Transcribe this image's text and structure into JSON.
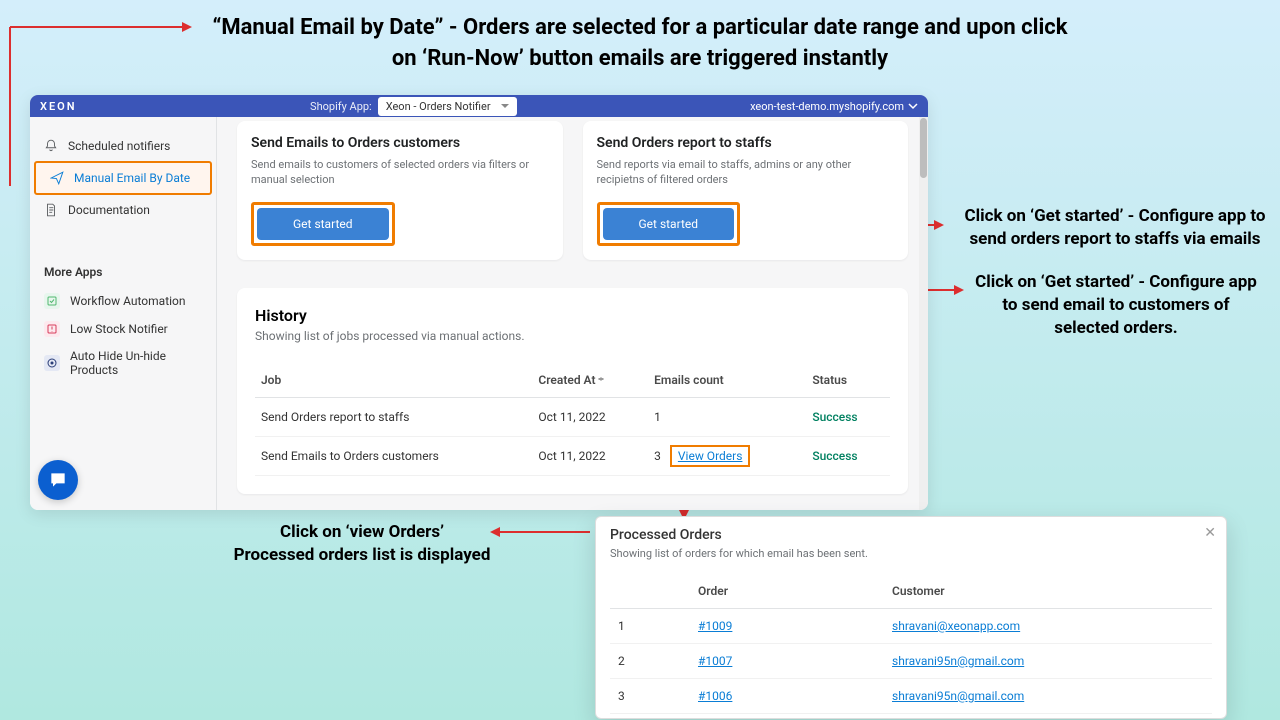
{
  "top_annotation": "“Manual Email by Date” - Orders are selected for a particular date range and upon click on ‘Run-Now’ button emails are triggered instantly",
  "header": {
    "brand": "XEON",
    "app_label": "Shopify App:",
    "app_selected": "Xeon - Orders Notifier",
    "shop_url": "xeon-test-demo.myshopify.com"
  },
  "sidebar": {
    "items": [
      {
        "label": "Scheduled notifiers",
        "icon": "bell-icon"
      },
      {
        "label": "Manual Email By Date",
        "icon": "paper-plane-icon",
        "active": true
      },
      {
        "label": "Documentation",
        "icon": "document-icon"
      }
    ],
    "more_apps_title": "More Apps",
    "apps": [
      {
        "label": "Workflow Automation",
        "icon_color": "#50b86f"
      },
      {
        "label": "Low Stock Notifier",
        "icon_color": "#d83a5a"
      },
      {
        "label": "Auto Hide Un-hide Products",
        "icon_color": "#2b3e78"
      }
    ]
  },
  "cards": [
    {
      "title": "Send Emails to Orders customers",
      "desc": "Send emails to customers of selected orders via filters or manual selection",
      "cta": "Get started"
    },
    {
      "title": "Send Orders report to staffs",
      "desc": "Send reports via email to staffs, admins or any other recipietns of filtered orders",
      "cta": "Get started"
    }
  ],
  "history": {
    "title": "History",
    "subtitle": "Showing list of jobs processed via manual actions.",
    "columns": {
      "job": "Job",
      "created": "Created At",
      "count": "Emails count",
      "status": "Status"
    },
    "rows": [
      {
        "job": "Send Orders report to staffs",
        "created": "Oct 11, 2022",
        "count": "1",
        "status": "Success"
      },
      {
        "job": "Send Emails to Orders customers",
        "created": "Oct 11, 2022",
        "count": "3",
        "status": "Success",
        "view": "View Orders"
      }
    ]
  },
  "modal": {
    "title": "Processed Orders",
    "subtitle": "Showing list of orders for which email has been sent.",
    "columns": {
      "order": "Order",
      "customer": "Customer"
    },
    "rows": [
      {
        "idx": "1",
        "order": "#1009",
        "customer": "shravani@xeonapp.com"
      },
      {
        "idx": "2",
        "order": "#1007",
        "customer": "shravani95n@gmail.com"
      },
      {
        "idx": "3",
        "order": "#1006",
        "customer": "shravani95n@gmail.com"
      }
    ]
  },
  "annotations": {
    "right1": "Click on ‘Get started’ - Configure app to send orders report to staffs via emails",
    "right2": "Click on ‘Get started’ - Configure app to send email to customers of selected orders.",
    "bottom": "Click on ‘view Orders’\nProcessed orders list is displayed"
  }
}
